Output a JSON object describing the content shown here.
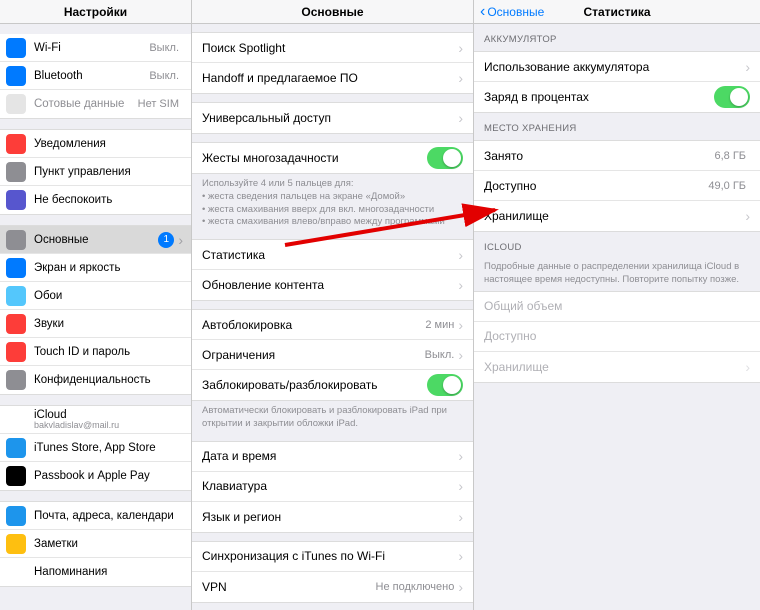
{
  "left": {
    "title": "Настройки",
    "g1": [
      {
        "label": "Wi-Fi",
        "value": "Выкл.",
        "icon_bg": "#007aff"
      },
      {
        "label": "Bluetooth",
        "value": "Выкл.",
        "icon_bg": "#007aff"
      },
      {
        "label": "Сотовые данные",
        "value": "Нет SIM",
        "icon_bg": "#e5e5e5",
        "dim": true
      }
    ],
    "g2": [
      {
        "label": "Уведомления",
        "icon_bg": "#fd3d39"
      },
      {
        "label": "Пункт управления",
        "icon_bg": "#8e8e93"
      },
      {
        "label": "Не беспокоить",
        "icon_bg": "#5756ce"
      }
    ],
    "g3": [
      {
        "label": "Основные",
        "icon_bg": "#8e8e93",
        "selected": true,
        "badge": "1"
      },
      {
        "label": "Экран и яркость",
        "icon_bg": "#007aff"
      },
      {
        "label": "Обои",
        "icon_bg": "#54c7fc"
      },
      {
        "label": "Звуки",
        "icon_bg": "#fd3d39"
      },
      {
        "label": "Touch ID и пароль",
        "icon_bg": "#fd3d39"
      },
      {
        "label": "Конфиденциальность",
        "icon_bg": "#8e8e93"
      }
    ],
    "g4": [
      {
        "label": "iCloud",
        "sub": "bakvladislav@mail.ru",
        "icon_bg": "#ffffff"
      },
      {
        "label": "iTunes Store, App Store",
        "icon_bg": "#1d95ec"
      },
      {
        "label": "Passbook и Apple Pay",
        "icon_bg": "#000000"
      }
    ],
    "g5": [
      {
        "label": "Почта, адреса, календари",
        "icon_bg": "#1d95ec"
      },
      {
        "label": "Заметки",
        "icon_bg": "#febf10"
      },
      {
        "label": "Напоминания",
        "icon_bg": "#ffffff"
      }
    ]
  },
  "mid": {
    "title": "Основные",
    "g1": [
      {
        "label": "Поиск Spotlight"
      },
      {
        "label": "Handoff и предлагаемое ПО"
      }
    ],
    "g2": [
      {
        "label": "Универсальный доступ"
      }
    ],
    "g3": [
      {
        "label": "Жесты многозадачности",
        "toggle": true
      }
    ],
    "g3_footer": "Используйте 4 или 5 пальцев для:\n• жеста сведения пальцев на экране «Домой»\n• жеста смахивания вверх для вкл. многозадачности\n• жеста смахивания влево/вправо между программами",
    "g4": [
      {
        "label": "Статистика"
      },
      {
        "label": "Обновление контента"
      }
    ],
    "g5": [
      {
        "label": "Автоблокировка",
        "value": "2 мин"
      },
      {
        "label": "Ограничения",
        "value": "Выкл."
      },
      {
        "label": "Заблокировать/разблокировать",
        "toggle": true
      }
    ],
    "g5_footer": "Автоматически блокировать и разблокировать iPad при открытии и закрытии обложки iPad.",
    "g6": [
      {
        "label": "Дата и время"
      },
      {
        "label": "Клавиатура"
      },
      {
        "label": "Язык и регион"
      }
    ],
    "g7": [
      {
        "label": "Синхронизация с iTunes по Wi-Fi"
      },
      {
        "label": "VPN",
        "value": "Не подключено"
      }
    ]
  },
  "right": {
    "back": "Основные",
    "title": "Статистика",
    "sect1_hdr": "АККУМУЛЯТОР",
    "sect1": [
      {
        "label": "Использование аккумулятора"
      },
      {
        "label": "Заряд в процентах",
        "toggle": true
      }
    ],
    "sect2_hdr": "МЕСТО ХРАНЕНИЯ",
    "sect2": [
      {
        "label": "Занято",
        "value": "6,8 ГБ",
        "nochev": true
      },
      {
        "label": "Доступно",
        "value": "49,0 ГБ",
        "nochev": true
      },
      {
        "label": "Хранилище"
      }
    ],
    "sect3_hdr": "ICLOUD",
    "sect3_note": "Подробные данные о распределении хранилища iCloud в настоящее время недоступны. Повторите попытку позже.",
    "sect3": [
      {
        "label": "Общий объем",
        "dim": true,
        "nochev": true
      },
      {
        "label": "Доступно",
        "dim": true,
        "nochev": true
      },
      {
        "label": "Хранилище",
        "dim": true
      }
    ]
  }
}
